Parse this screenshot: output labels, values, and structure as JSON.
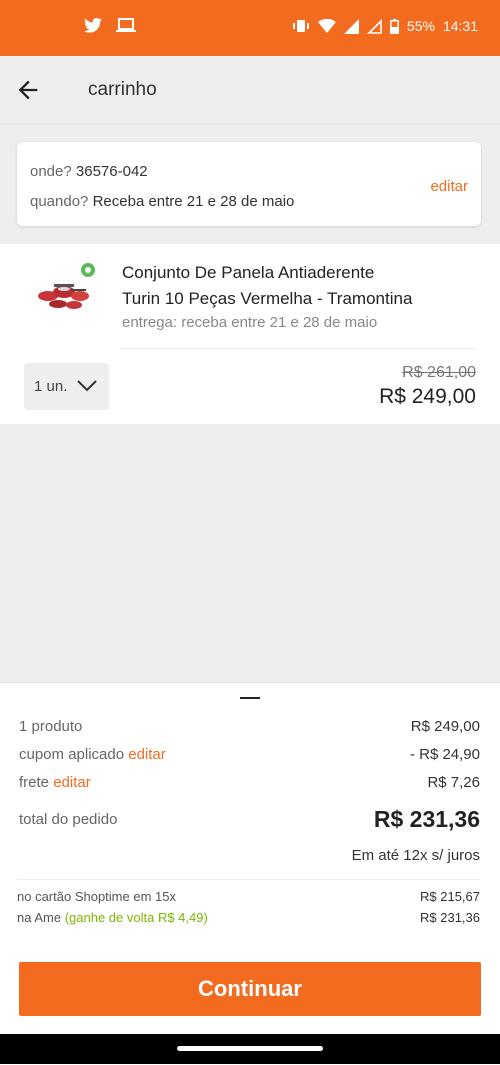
{
  "status_bar": {
    "battery": "55%",
    "time": "14:31",
    "icons": [
      "twitter-icon",
      "laptop-icon",
      "vibrate-icon",
      "wifi-icon",
      "signal-icon",
      "signal-outline-icon",
      "battery-icon"
    ]
  },
  "header": {
    "title": "carrinho"
  },
  "delivery": {
    "where_label": "onde?",
    "where_value": "36576-042",
    "when_label": "quando?",
    "when_value": "Receba entre 21 e 28 de maio",
    "edit_label": "editar"
  },
  "product": {
    "name_line1": "Conjunto De Panela Antiaderente",
    "name_line2": "Turin 10 Peças Vermelha - Tramontina",
    "delivery_note": "entrega: receba entre 21 e 28 de maio",
    "quantity": "1 un.",
    "old_price": "R$ 261,00",
    "price": "R$ 249,00"
  },
  "summary": {
    "products_label": "1 produto",
    "products_value": "R$ 249,00",
    "coupon_label": "cupom aplicado",
    "coupon_edit": "editar",
    "coupon_value": "- R$ 24,90",
    "shipping_label": "frete",
    "shipping_edit": "editar",
    "shipping_value": "R$ 7,26",
    "total_label": "total do pedido",
    "total_value": "R$ 231,36",
    "installments": "Em até 12x s/ juros",
    "card_label": "no cartão Shoptime em 15x",
    "card_value": "R$ 215,67",
    "ame_label": "na Ame",
    "ame_cashback": "(ganhe de volta R$ 4,49)",
    "ame_value": "R$ 231,36",
    "cta_label": "Continuar"
  },
  "colors": {
    "accent": "#f36b1f",
    "green": "#7ab800"
  }
}
